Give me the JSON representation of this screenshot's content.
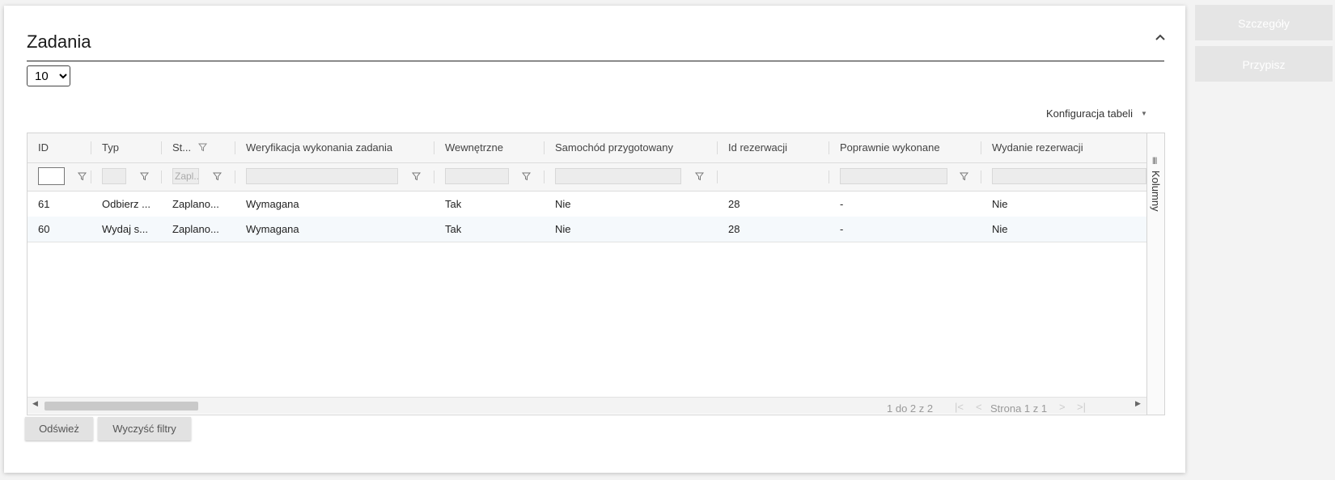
{
  "panel": {
    "title": "Zadania",
    "page_size": "10",
    "page_size_options": [
      "10"
    ],
    "table_config_label": "Konfiguracja tabeli"
  },
  "table": {
    "columns": [
      {
        "label": "ID"
      },
      {
        "label": "Typ"
      },
      {
        "label": "St..."
      },
      {
        "label": "Weryfikacja wykonania zadania"
      },
      {
        "label": "Wewnętrzne"
      },
      {
        "label": "Samochód przygotowany"
      },
      {
        "label": "Id rezerwacji"
      },
      {
        "label": "Poprawnie wykonane"
      },
      {
        "label": "Wydanie rezerwacji"
      }
    ],
    "status_filter_value": "Zapl...",
    "rows": [
      {
        "id": "61",
        "typ": "Odbierz ...",
        "status": "Zaplano...",
        "weryfikacja": "Wymagana",
        "wewnetrzne": "Tak",
        "samochod": "Nie",
        "id_rezerwacji": "28",
        "poprawnie": "-",
        "wydanie": "Nie"
      },
      {
        "id": "60",
        "typ": "Wydaj s...",
        "status": "Zaplano...",
        "weryfikacja": "Wymagana",
        "wewnetrzne": "Tak",
        "samochod": "Nie",
        "id_rezerwacji": "28",
        "poprawnie": "-",
        "wydanie": "Nie"
      }
    ],
    "columns_panel_label": "Kolumny"
  },
  "pagination": {
    "summary": "1 do 2 z 2",
    "page_label": "Strona 1 z 1"
  },
  "buttons": {
    "refresh": "Odśwież",
    "clear_filters": "Wyczyść filtry"
  },
  "side_actions": {
    "details": "Szczegóły",
    "assign": "Przypisz"
  }
}
